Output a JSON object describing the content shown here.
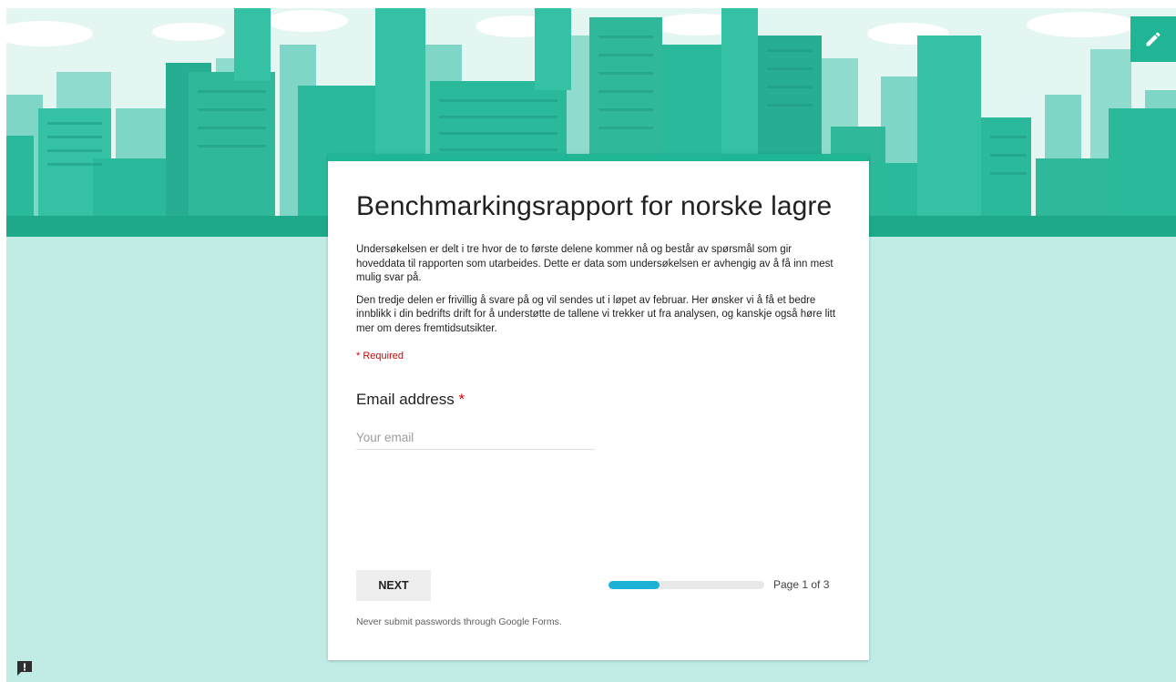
{
  "banner": {
    "icon": "city-skyline-illustration"
  },
  "edit": {
    "icon": "pencil-icon",
    "color": "#1fb595"
  },
  "form": {
    "title": "Benchmarkingsrapport for norske lagre",
    "description": [
      "Undersøkelsen er delt i tre hvor de to første delene kommer nå og består av spørsmål som gir hoveddata til rapporten som utarbeides. Dette er data som undersøkelsen er avhengig av å få inn mest mulig svar på.",
      "Den tredje delen er frivillig å svare på og vil sendes ut i løpet av februar. Her ønsker vi å få et bedre innblikk i din bedrifts drift for å understøtte de tallene vi trekker ut fra analysen, og kanskje også høre litt mer om deres fremtidsutsikter."
    ],
    "required_note": "* Required",
    "question": {
      "title": "Email address",
      "required_mark": "*",
      "placeholder": "Your email",
      "value": ""
    },
    "next_label": "NEXT",
    "progress": {
      "fraction": 0.33
    },
    "page_label": "Page 1 of 3",
    "footer_note": "Never submit passwords through Google Forms."
  },
  "colors": {
    "accent": "#1fb595",
    "background": "#c0ece5",
    "progress": "#1cb2d6",
    "required": "#d50000"
  },
  "feedback": {
    "icon": "feedback-icon"
  }
}
